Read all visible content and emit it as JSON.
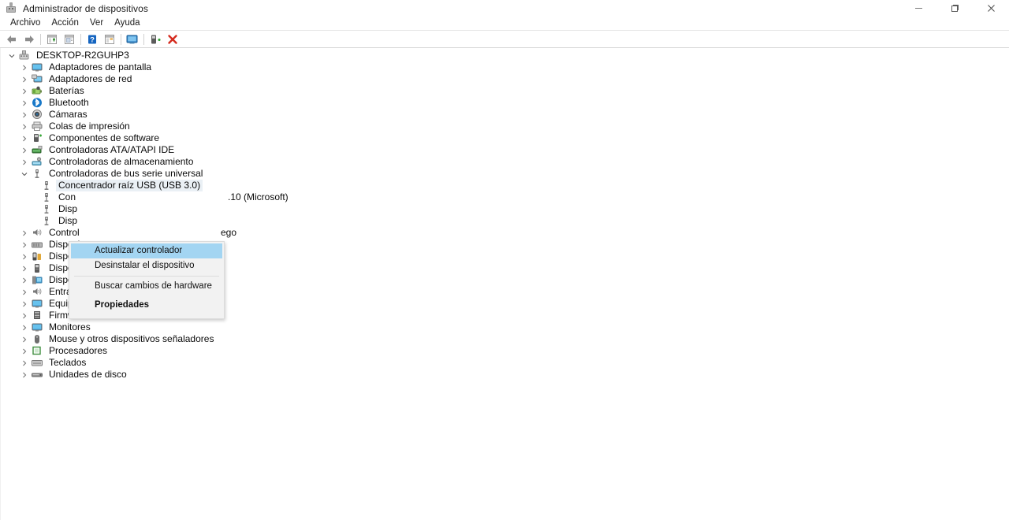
{
  "window": {
    "title": "Administrador de dispositivos",
    "title_icon": "device-manager-icon",
    "controls": {
      "minimize_label": "Minimizar",
      "maximize_label": "Maximizar",
      "close_label": "Cerrar"
    }
  },
  "menubar": {
    "items": [
      {
        "label": "Archivo",
        "name": "menu-archivo"
      },
      {
        "label": "Acción",
        "name": "menu-accion"
      },
      {
        "label": "Ver",
        "name": "menu-ver"
      },
      {
        "label": "Ayuda",
        "name": "menu-ayuda"
      }
    ]
  },
  "toolbar": {
    "buttons": [
      {
        "icon": "back-arrow-icon",
        "tooltip": "Atrás"
      },
      {
        "icon": "forward-arrow-icon",
        "tooltip": "Adelante"
      },
      {
        "icon": "show-hide-console-tree-icon",
        "tooltip": "Mostrar u ocultar árbol de consola"
      },
      {
        "icon": "properties-icon",
        "tooltip": "Propiedades"
      },
      {
        "icon": "help-icon",
        "tooltip": "Ayuda"
      },
      {
        "icon": "view-icon",
        "tooltip": "Ver"
      },
      {
        "icon": "scan-hardware-icon",
        "tooltip": "Buscar cambios de hardware"
      },
      {
        "icon": "update-driver-icon",
        "tooltip": "Actualizar controlador"
      },
      {
        "icon": "uninstall-device-icon",
        "tooltip": "Desinstalar el dispositivo"
      }
    ]
  },
  "tree": {
    "root": {
      "label": "DESKTOP-R2GUHP3",
      "icon": "computer-icon",
      "expanded": true
    },
    "items": [
      {
        "label": "Adaptadores de pantalla",
        "icon": "display-adapter-icon",
        "level": 1,
        "expanded": false
      },
      {
        "label": "Adaptadores de red",
        "icon": "network-adapter-icon",
        "level": 1,
        "expanded": false
      },
      {
        "label": "Baterías",
        "icon": "battery-icon",
        "level": 1,
        "expanded": false
      },
      {
        "label": "Bluetooth",
        "icon": "bluetooth-icon",
        "level": 1,
        "expanded": false
      },
      {
        "label": "Cámaras",
        "icon": "camera-icon",
        "level": 1,
        "expanded": false
      },
      {
        "label": "Colas de impresión",
        "icon": "print-queue-icon",
        "level": 1,
        "expanded": false
      },
      {
        "label": "Componentes de software",
        "icon": "software-component-icon",
        "level": 1,
        "expanded": false
      },
      {
        "label": "Controladoras ATA/ATAPI IDE",
        "icon": "ide-controller-icon",
        "level": 1,
        "expanded": false
      },
      {
        "label": "Controladoras de almacenamiento",
        "icon": "storage-controller-icon",
        "level": 1,
        "expanded": false
      },
      {
        "label": "Controladoras de bus serie universal",
        "icon": "usb-controller-icon",
        "level": 1,
        "expanded": true
      },
      {
        "label": "Concentrador raíz USB (USB 3.0)",
        "icon": "usb-hub-icon",
        "level": 2,
        "selected": true
      },
      {
        "label": "Con",
        "label_suffix": ".10 (Microsoft)",
        "icon": "usb-hub-icon",
        "level": 2,
        "occluded": true
      },
      {
        "label": "Disp",
        "icon": "usb-device-icon",
        "level": 2,
        "occluded": true
      },
      {
        "label": "Disp",
        "icon": "usb-device-icon",
        "level": 2,
        "occluded": true
      },
      {
        "label": "Control",
        "label_suffix": "ego",
        "icon": "sound-controller-icon",
        "level": 1,
        "expanded": false,
        "occluded": true
      },
      {
        "label": "Disposi",
        "icon": "imaging-device-icon",
        "level": 1,
        "expanded": false,
        "occluded": true
      },
      {
        "label": "Disposi",
        "icon": "portable-device-icon",
        "level": 1,
        "expanded": false,
        "occluded": true
      },
      {
        "label": "Dispositivos de software",
        "icon": "software-device-icon",
        "level": 1,
        "expanded": false
      },
      {
        "label": "Dispositivos del sistema",
        "icon": "system-device-icon",
        "level": 1,
        "expanded": false
      },
      {
        "label": "Entradas y salidas de audio",
        "icon": "audio-io-icon",
        "level": 1,
        "expanded": false
      },
      {
        "label": "Equipo",
        "icon": "computer-node-icon",
        "level": 1,
        "expanded": false
      },
      {
        "label": "Firmware",
        "icon": "firmware-icon",
        "level": 1,
        "expanded": false
      },
      {
        "label": "Monitores",
        "icon": "monitor-icon",
        "level": 1,
        "expanded": false
      },
      {
        "label": "Mouse y otros dispositivos señaladores",
        "icon": "mouse-icon",
        "level": 1,
        "expanded": false
      },
      {
        "label": "Procesadores",
        "icon": "processor-icon",
        "level": 1,
        "expanded": false
      },
      {
        "label": "Teclados",
        "icon": "keyboard-icon",
        "level": 1,
        "expanded": false
      },
      {
        "label": "Unidades de disco",
        "icon": "disk-drive-icon",
        "level": 1,
        "expanded": false
      }
    ]
  },
  "context_menu": {
    "items": [
      {
        "label": "Actualizar controlador",
        "highlighted": true,
        "bold": false
      },
      {
        "label": "Desinstalar el dispositivo",
        "highlighted": false,
        "bold": false
      },
      {
        "separator": true
      },
      {
        "label": "Buscar cambios de hardware",
        "highlighted": false,
        "bold": false
      },
      {
        "label": "Propiedades",
        "highlighted": false,
        "bold": true
      }
    ]
  },
  "colors": {
    "menu_highlight": "#a3d5f2",
    "selection": "#eaf0f5",
    "menu_background": "#f2f2f2",
    "accent_red": "#d42b1e",
    "accent_blue": "#1079c8",
    "accent_green": "#34a334"
  }
}
